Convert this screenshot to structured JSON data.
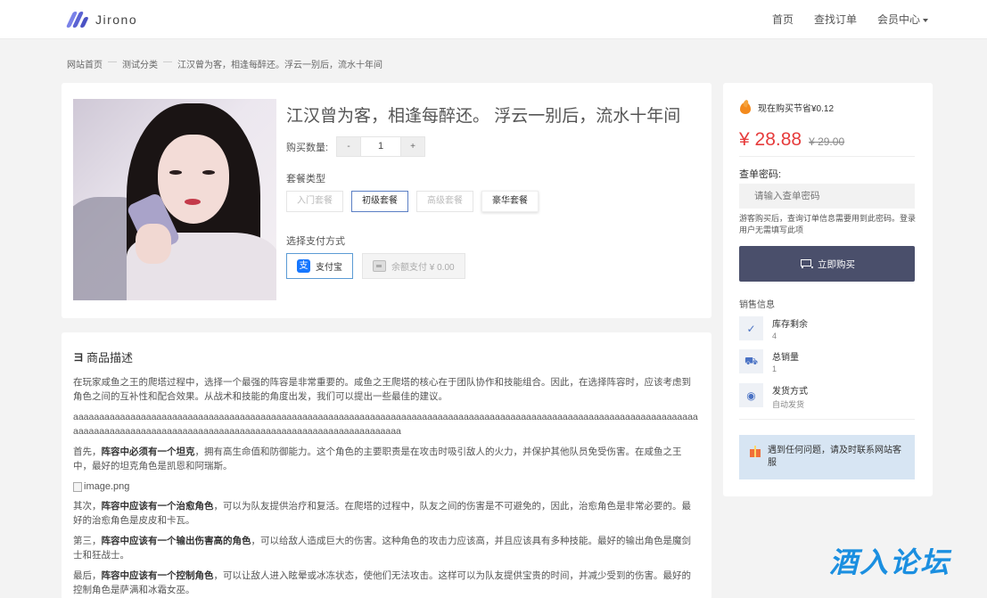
{
  "header": {
    "logo_text": "Jirono",
    "nav": {
      "home": "首页",
      "order": "查找订单",
      "member": "会员中心"
    }
  },
  "breadcrumb": {
    "home": "网站首页",
    "category": "测试分类",
    "current": "江汉曾为客，相逢每醉还。浮云一别后，流水十年间",
    "sep": "—"
  },
  "product": {
    "title": "江汉曾为客，相逢每醉还。 浮云一别后，流水十年间",
    "qty_label": "购买数量:",
    "qty_minus": "-",
    "qty_value": "1",
    "qty_plus": "+",
    "package_label": "套餐类型",
    "packages": [
      "入门套餐",
      "初级套餐",
      "高级套餐",
      "豪华套餐"
    ],
    "pay_label": "选择支付方式",
    "pay_alipay": "支付宝",
    "pay_alipay_glyph": "支",
    "pay_balance": "余额支付 ¥ 0.00"
  },
  "description": {
    "heading_icon": "ヨ",
    "heading": "商品描述",
    "p1": "在玩家咸鱼之王的爬塔过程中，选择一个最强的阵容是非常重要的。咸鱼之王爬塔的核心在于团队协作和技能组合。因此，在选择阵容时，应该考虑到角色之间的互补性和配合效果。从战术和技能的角度出发，我们可以提出一些最佳的建议。",
    "p_aaa": "aaaaaaaaaaaaaaaaaaaaaaaaaaaaaaaaaaaaaaaaaaaaaaaaaaaaaaaaaaaaaaaaaaaaaaaaaaaaaaaaaaaaaaaaaaaaaaaaaaaaaaaaaaaaaaaaaaaaaaaaaaaaaaaaaaaaaaaaaaaaaaaaaaaaaaaaaaaaaaaaaaaaaaaaaaaaaaaaaaaaaaa",
    "p2_pre": "首先，",
    "p2_bold": "阵容中必须有一个坦克",
    "p2_post": "，拥有高生命值和防御能力。这个角色的主要职责是在攻击时吸引敌人的火力，并保护其他队员免受伤害。在咸鱼之王中，最好的坦克角色是凯恩和阿瑞斯。",
    "img_alt": "image.png",
    "p3_pre": "其次，",
    "p3_bold": "阵容中应该有一个治愈角色",
    "p3_post": "，可以为队友提供治疗和复活。在爬塔的过程中，队友之间的伤害是不可避免的，因此，治愈角色是非常必要的。最好的治愈角色是皮皮和卡瓦。",
    "p4_pre": "第三，",
    "p4_bold": "阵容中应该有一个输出伤害高的角色",
    "p4_post": "，可以给敌人造成巨大的伤害。这种角色的攻击力应该高，并且应该具有多种技能。最好的输出角色是魔剑士和狂战士。",
    "p5_pre": "最后，",
    "p5_bold": "阵容中应该有一个控制角色",
    "p5_post": "，可以让敌人进入眩晕或冰冻状态，使他们无法攻击。这样可以为队友提供宝贵的时间，并减少受到的伤害。最好的控制角色是萨满和冰霜女巫。"
  },
  "sidebar": {
    "save_tip": "现在购买节省¥0.12",
    "price_now": "¥ 28.88",
    "price_old": "¥ 29.00",
    "pwd_label": "查单密码:",
    "pwd_placeholder": "请输入查单密码",
    "pwd_hint": "游客购买后，查询订单信息需要用到此密码。登录用户无需填写此项",
    "buy_label": "立即购买",
    "sales_title": "销售信息",
    "stock_label": "库存剩余",
    "stock_value": "4",
    "sold_label": "总销量",
    "sold_value": "1",
    "ship_label": "发货方式",
    "ship_value": "自动发货",
    "tip": "遇到任何问题，请及时联系网站客服"
  },
  "watermark": "酒入论坛",
  "colors": {
    "accent": "#4a4f6b",
    "price": "#e63c3c",
    "brand": "#5b63d3",
    "tip_bg": "#d7e5f3"
  }
}
